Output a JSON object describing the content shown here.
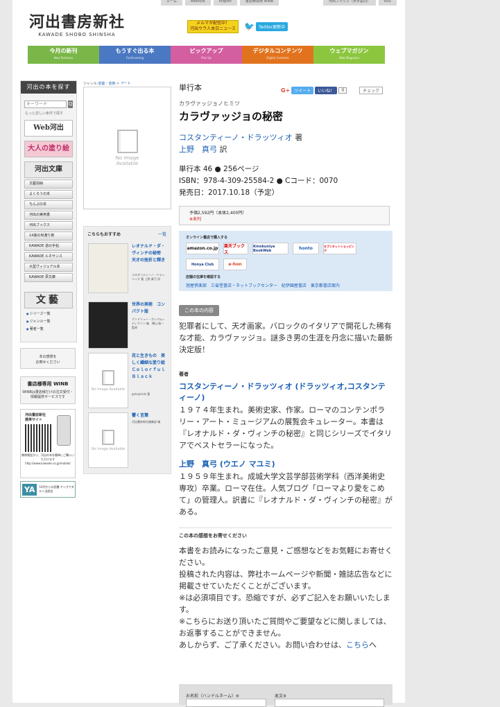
{
  "top_links": [
    "ホーム",
    "Web河出",
    "English",
    "書店様専用 WINB",
    "河出ブックス（大学案内）",
    "RSS"
  ],
  "logo": {
    "jp": "河出書房新社",
    "en": "KAWADE SHOBO SHINSHA"
  },
  "mail_banner": "メルマガ配信中！",
  "mail_sub": "河出ウラ人本日ニュース",
  "twitter": "Twitter更新中",
  "gnav": [
    {
      "label": "今月の新刊",
      "sub": "New Releases",
      "color": "#7ab648"
    },
    {
      "label": "もうすぐ出る本",
      "sub": "Forthcoming",
      "color": "#4a78c2"
    },
    {
      "label": "ピックアップ",
      "sub": "Pick Up",
      "color": "#d45fa0"
    },
    {
      "label": "デジタルコンテンツ",
      "sub": "Digital Contents",
      "color": "#e2731e"
    },
    {
      "label": "ウェブマガジン",
      "sub": "Web Magazine",
      "color": "#8cc63f"
    }
  ],
  "sidebar": {
    "title": "河出の本を探す",
    "search_placeholder": "キーワード",
    "search_btn": "Q",
    "advanced": "もっと詳しい条件で探す",
    "web": "Web河出",
    "nurie": "大人の塗り絵",
    "bunko": "河出文庫",
    "subs": [
      "文藝別冊",
      "よくろうの本",
      "ちんぷの本",
      "河出の実用書",
      "河出ブックス",
      "14歳の世渡り術",
      "KAWADE 道の手帖",
      "KAWADE ルネサンス",
      "大型ヴィジュアル本",
      "KAWADE 夢文庫"
    ],
    "bungei": "文藝",
    "links": [
      "シリーズ一覧",
      "ジャンル一覧",
      "著者一覧"
    ]
  },
  "banners": {
    "b1": "本の感想を\nお寄せください",
    "b2_title": "書店様専用 WINB",
    "b2_text": "WINBは書店様だけの注文受付・情報提供サービスです",
    "b3_title": "河出書房新社\n携帯サイト",
    "b3_text": "携帯電話から、河出の本を簡単にご購入いただけます\nhttp://www.kawade.co.jp/mobile/",
    "b4_logo": "YA",
    "b4_text": "10代からの読書 ヤングアダルト出版会"
  },
  "breadcrumb": {
    "prefix": "ジャンル:",
    "genre": "芸能・芸術",
    "sep": ">",
    "sub": "アート"
  },
  "cover_noimage": "No Image Available",
  "recommend": {
    "title": "こちらもおすすめ",
    "all": "一覧",
    "items": [
      {
        "title": "レオナルド・ダ・ヴィンチの秘密　天才の挫折と輝き",
        "author": "コスタンティーノ・ドラッツィオ 著 上野 真弓 訳"
      },
      {
        "title": "世界の美術　コンパクト版",
        "author": "アンドリュー・グレアム=ディクソン 編　樺山 紘一 監修"
      },
      {
        "title": "花と生きもの　美しく繊細な塗り絵　Ｃｏｌｏｒｆｕｌ　Ｂｌａｃｋ",
        "author": "gutsybirds 著"
      },
      {
        "title": "響く言葉",
        "author": "河出書房新社編集部 編"
      }
    ]
  },
  "book": {
    "format": "単行本",
    "kana": "カラヴァッジョノヒミツ",
    "title": "カラヴァッジョの秘密",
    "author1": "コスタンティーノ・ドラッツィオ",
    "author1_role": "著",
    "author2": "上野　真弓",
    "author2_role": "訳",
    "spec": "単行本 46 ● 256ページ",
    "isbn": "ISBN：978-4-309-25584-2 ● Cコード：0070",
    "date": "発売日：2017.10.18（予定）",
    "price": "予価2,592円（本体2,400円）",
    "stock": "※未刊",
    "shop_title": "オンライン書店で購入する",
    "shops": [
      "amazon.co.jp",
      "楽天ブックス",
      "Kinokuniya BookWeb",
      "honto",
      "セブンネットショッピング",
      "Honya Club",
      "e-hon"
    ],
    "stores_title": "店舗の在庫を確認する",
    "stores": [
      "旭屋倶楽部",
      "三省堂書店・ネットブックセンター",
      "紀伊國屋書店",
      "東京都書店案内"
    ],
    "content_tag": "この本の内容",
    "description": "犯罪者にして、天才画家。バロックのイタリアで開花した稀有な才能、カラヴァッジョ。謎多き男の生涯を丹念に描いた最新決定版！",
    "author_heading": "著者",
    "a1_name": "コスタンティーノ・ドラッツィオ (ドラッツィオ,コスタンティーノ)",
    "a1_bio": "１９７４年生まれ。美術史家、作家。ローマのコンテンポラリー・アート・ミュージアムの展覧会キュレーター。本書は『レオナルド・ダ・ヴィンチの秘密』と同じシリーズでイタリアでベストセラーになった。",
    "a2_name": "上野　真弓 (ウエノ マユミ)",
    "a2_bio": "１９５９年生まれ。成城大学文芸学部芸術学科（西洋美術史専攻）卒業。ローマ在住。人気ブログ「ローマより愛をこめて」の管理人。訳書に『レオナルド・ダ・ヴィンチの秘密』がある。",
    "feedback_heading": "この本の感想をお寄せください",
    "fb1": "本書をお読みになったご意見・ご感想などをお気軽にお寄せください。",
    "fb2": "投稿された内容は、弊社ホームページや新聞・雑誌広告などに掲載させていただくことがございます。",
    "fb3": "※は必須項目です。恐縮ですが、必ずご記入をお願いいたします。",
    "fb4": "※こちらにお送り頂いたご質問やご要望などに関しましては、お返事することができません。",
    "fb5_pre": "あしからず、ご了承ください。お問い合わせは、",
    "fb5_link": "こちら",
    "fb5_post": "へ",
    "form_name": "お名前（ハンドルネーム）※",
    "form_body": "本文※"
  },
  "social": {
    "gplus": "G+",
    "tweet": "ツイート",
    "like": "いいね！",
    "like_count": "0",
    "check": "チェック"
  }
}
